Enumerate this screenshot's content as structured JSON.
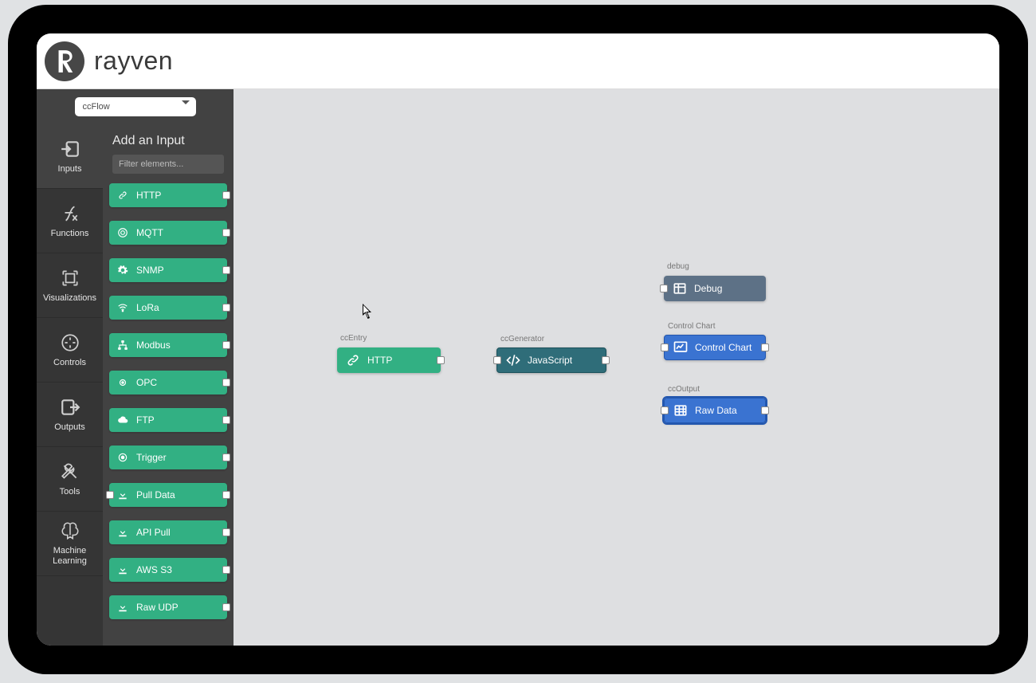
{
  "brand": {
    "name": "rayven"
  },
  "flow_select": {
    "value": "ccFlow"
  },
  "sidenav": {
    "items": [
      {
        "label": "Inputs"
      },
      {
        "label": "Functions"
      },
      {
        "label": "Visualizations"
      },
      {
        "label": "Controls"
      },
      {
        "label": "Outputs"
      },
      {
        "label": "Tools"
      },
      {
        "label": "Machine Learning"
      }
    ]
  },
  "palette": {
    "title": "Add an Input",
    "filter_placeholder": "Filter elements...",
    "items": [
      {
        "label": "HTTP"
      },
      {
        "label": "MQTT"
      },
      {
        "label": "SNMP"
      },
      {
        "label": "LoRa"
      },
      {
        "label": "Modbus"
      },
      {
        "label": "OPC"
      },
      {
        "label": "FTP"
      },
      {
        "label": "Trigger"
      },
      {
        "label": "Pull Data"
      },
      {
        "label": "API Pull"
      },
      {
        "label": "AWS S3"
      },
      {
        "label": "Raw UDP"
      }
    ]
  },
  "canvas": {
    "nodes": {
      "entry": {
        "caption": "ccEntry",
        "label": "HTTP"
      },
      "generator": {
        "caption": "ccGenerator",
        "label": "JavaScript"
      },
      "debug": {
        "caption": "debug",
        "label": "Debug"
      },
      "chart": {
        "caption": "Control Chart",
        "label": "Control Chart"
      },
      "output": {
        "caption": "ccOutput",
        "label": "Raw Data"
      }
    }
  }
}
